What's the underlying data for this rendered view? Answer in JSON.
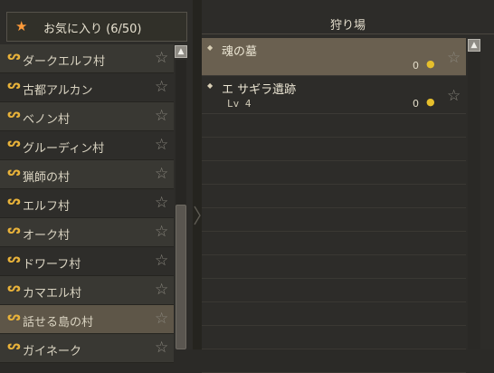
{
  "favorites": {
    "title": "お気に入り (6/50)",
    "items": [
      {
        "label": "ダークエルフ村"
      },
      {
        "label": "古都アルカン"
      },
      {
        "label": "ベノン村"
      },
      {
        "label": "グルーディン村"
      },
      {
        "label": "猟師の村"
      },
      {
        "label": "エルフ村"
      },
      {
        "label": "オーク村"
      },
      {
        "label": "ドワーフ村"
      },
      {
        "label": "カマエル村"
      },
      {
        "label": "話せる島の村"
      },
      {
        "label": "ガイネーク"
      }
    ],
    "selected_index": 9,
    "icons": {
      "header": "star-icon",
      "location": "teleport-icon",
      "favorite": "star-outline-icon"
    },
    "colors": {
      "header_star": "#ff9b3a",
      "location_icon": "#e8b23a",
      "selected_row": "#5e5648"
    }
  },
  "hunting": {
    "title": "狩り場",
    "rows": [
      {
        "name": "魂の墓",
        "level": "",
        "count": "0"
      },
      {
        "name": "エ サギラ遺跡",
        "level": "Lv 4",
        "count": "0"
      }
    ],
    "selected_index": 0,
    "icons": {
      "bullet": "diamond-icon",
      "currency": "coin-icon",
      "favorite": "star-outline-icon"
    },
    "colors": {
      "coin": "#e6bf2c",
      "selected_row": "#6a6050"
    }
  }
}
